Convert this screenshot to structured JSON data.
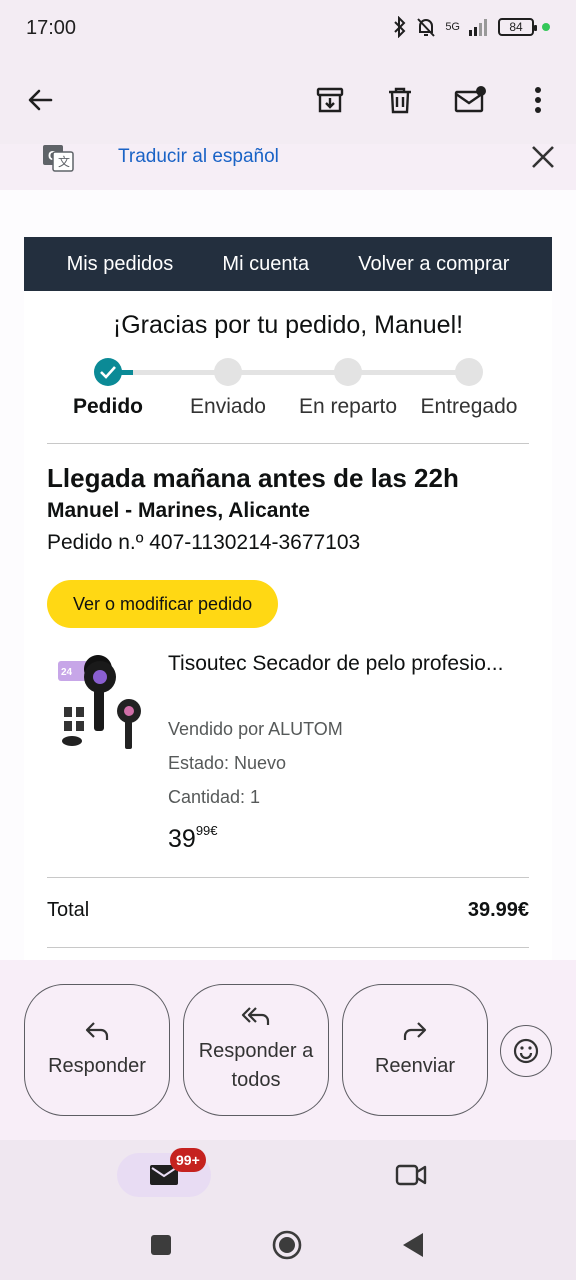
{
  "status_bar": {
    "time": "17:00",
    "network": "5G",
    "battery": "84"
  },
  "app_bar": {
    "icons": [
      "back-arrow-icon",
      "archive-icon",
      "delete-icon",
      "mark-unread-icon",
      "more-vert-icon"
    ]
  },
  "translate_bar": {
    "text": "Traducir al español",
    "icon": "translate-icon"
  },
  "email": {
    "nav": [
      "Mis pedidos",
      "Mi cuenta",
      "Volver a comprar"
    ],
    "greeting": "¡Gracias por tu pedido, Manuel!",
    "progress": {
      "steps": [
        "Pedido",
        "Enviado",
        "En reparto",
        "Entregado"
      ],
      "completed": 1,
      "accent": "#0b8a96"
    },
    "arrival": "Llegada mañana antes de las 22h",
    "address": "Manuel - Marines, Alicante",
    "order_number": "Pedido n.º 407-1130214-3677103",
    "view_button": "Ver o modificar pedido",
    "product": {
      "name": "Tisoutec Secador de pelo profesio...",
      "seller": "Vendido por ALUTOM",
      "condition": "Estado: Nuevo",
      "quantity": "Cantidad: 1",
      "price_int": "39",
      "price_dec": "99€"
    },
    "total_label": "Total",
    "total_value": "39.99€"
  },
  "actions": {
    "reply": "Responder",
    "reply_all": "Responder a todos",
    "forward": "Reenviar"
  },
  "bottom_nav": {
    "badge": "99+"
  },
  "colors": {
    "amazon_nav": "#232f3e",
    "button_yellow": "#ffd814",
    "link_blue": "#1a63c6",
    "badge_red": "#c5221f"
  }
}
